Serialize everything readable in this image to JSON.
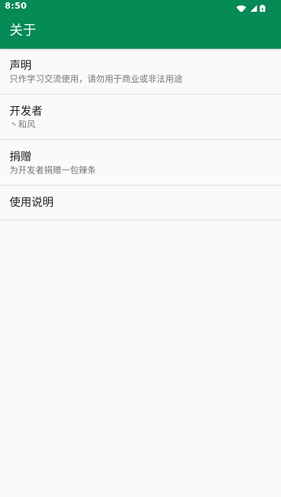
{
  "status_bar": {
    "time": "8:50",
    "icons": [
      "wifi-icon",
      "signal-icon",
      "battery-icon"
    ]
  },
  "app_bar": {
    "title": "关于"
  },
  "colors": {
    "primary": "#068a56",
    "background": "#fafafa",
    "divider": "#e0e0e0",
    "title_text": "#212121",
    "subtitle_text": "#757575"
  },
  "items": [
    {
      "title": "声明",
      "subtitle": "只作学习交流使用，请勿用于商业或非法用途"
    },
    {
      "title": "开发者",
      "subtitle": "丶和风"
    },
    {
      "title": "捐赠",
      "subtitle": "为开发者捐赠一包辣条"
    },
    {
      "title": "使用说明"
    }
  ]
}
